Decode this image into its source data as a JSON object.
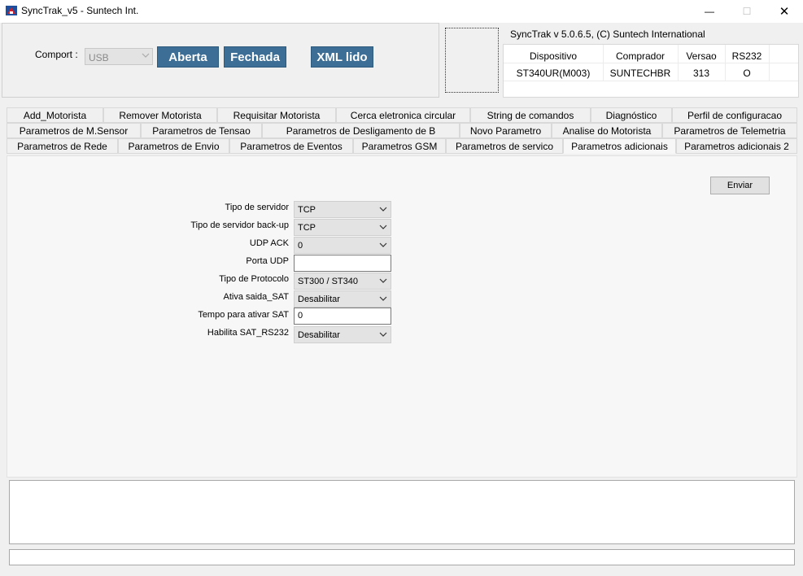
{
  "window": {
    "title": "SyncTrak_v5 - Suntech Int.",
    "minimize_glyph": "—",
    "maximize_glyph": "☐",
    "close_glyph": "✕"
  },
  "connection": {
    "comport_label": "Comport :",
    "comport_value": "USB",
    "open_button": "Aberta",
    "close_button": "Fechada",
    "xml_button": "XML lido"
  },
  "version": "SyncTrak v 5.0.6.5, (C) Suntech International",
  "device_table": {
    "headers": [
      "Dispositivo",
      "Comprador",
      "Versao",
      "RS232"
    ],
    "row": [
      "ST340UR(M003)",
      "SUNTECHBR",
      "313",
      "O"
    ]
  },
  "tabs": {
    "row1": [
      "Add_Motorista",
      "Remover Motorista",
      "Requisitar Motorista",
      "Cerca eletronica circular",
      "String de comandos",
      "Diagnóstico",
      "Perfil de configuracao"
    ],
    "row2": [
      "Parametros  de M.Sensor",
      "Parametros de Tensao",
      "Parametros de Desligamento de B",
      "Novo Parametro",
      "Analise do Motorista",
      "Parametros de Telemetria"
    ],
    "row3": [
      "Parametros de Rede",
      "Parametros de Envio",
      "Parametros de Eventos",
      "Parametros GSM",
      "Parametros de servico",
      "Parametros adicionais",
      "Parametros adicionais 2"
    ],
    "active": "Parametros adicionais"
  },
  "form": {
    "send_button": "Enviar",
    "fields": [
      {
        "label": "Tipo de servidor",
        "type": "select",
        "value": "TCP"
      },
      {
        "label": "Tipo de servidor back-up",
        "type": "select",
        "value": "TCP"
      },
      {
        "label": "UDP ACK",
        "type": "select",
        "value": "0"
      },
      {
        "label": "Porta UDP",
        "type": "input",
        "value": ""
      },
      {
        "label": "Tipo de Protocolo",
        "type": "select",
        "value": "ST300 / ST340"
      },
      {
        "label": "Ativa saida_SAT",
        "type": "select",
        "value": "Desabilitar"
      },
      {
        "label": "Tempo para ativar SAT",
        "type": "input",
        "value": "0"
      },
      {
        "label": "Habilita SAT_RS232",
        "type": "select",
        "value": "Desabilitar"
      }
    ]
  },
  "icons": {
    "app": "app-icon",
    "dropdown": "chevron-down-icon"
  }
}
